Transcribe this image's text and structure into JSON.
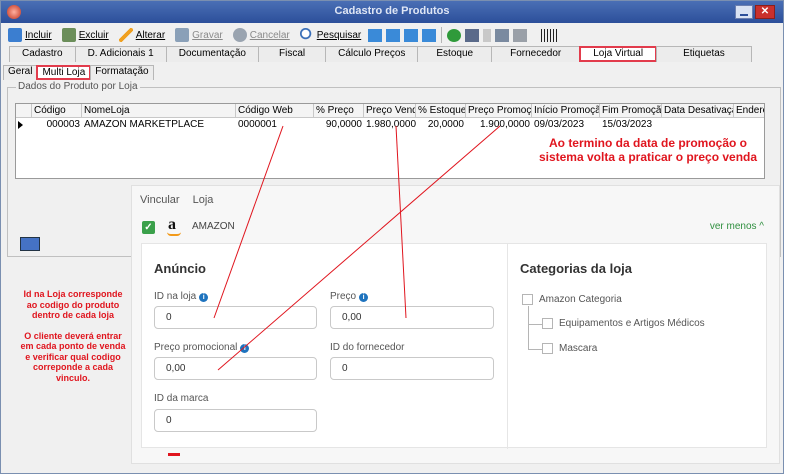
{
  "window": {
    "title": "Cadastro de Produtos"
  },
  "toolbar": {
    "incluir": "Incluir",
    "excluir": "Excluir",
    "alterar": "Alterar",
    "gravar": "Gravar",
    "cancelar": "Cancelar",
    "pesquisar": "Pesquisar"
  },
  "tabs_main": [
    "Cadastro",
    "D. Adicionais 1",
    "Documentação",
    "Fiscal",
    "Cálculo Preços",
    "Estoque",
    "Fornecedor",
    "Loja Virtual",
    "Etiquetas"
  ],
  "tabs_sub": [
    "Geral",
    "Multi Loja",
    "Formatação"
  ],
  "group": {
    "title": "Dados do Produto por Loja"
  },
  "grid": {
    "headers": [
      "Código",
      "NomeLoja",
      "Código Web",
      "% Preço",
      "Preço Venda",
      "% Estoque",
      "Preço Promoção",
      "Início  Promoção",
      "Fim Promoção",
      "Data Desativação",
      "Endereço"
    ],
    "row": [
      "000003",
      "AMAZON MARKETPLACE",
      "0000001",
      "90,0000",
      "1.980,0000",
      "20,0000",
      "1.900,0000",
      "09/03/2023",
      "15/03/2023",
      "",
      ""
    ]
  },
  "annotations": {
    "top_right_1": "Ao termino da data de promoção o",
    "top_right_2": "sistema volta a praticar o preço venda",
    "left_1": "Id na Loja corresponde",
    "left_2": "ao codigo do produto",
    "left_3": "dentro de cada loja",
    "left_4": "O cliente deverá entrar",
    "left_5": "em cada ponto de venda",
    "left_6": "e verificar qual codigo",
    "left_7": "correponde a cada",
    "left_8": "vinculo."
  },
  "overlay": {
    "vincular": "Vincular",
    "loja": "Loja",
    "store_name": "AMAZON",
    "ver_menos": "ver menos ^",
    "anuncio": "Anúncio",
    "id_na_loja_label": "ID na loja",
    "id_na_loja_value": "0",
    "preco_label": "Preço",
    "preco_value": "0,00",
    "preco_promocional_label": "Preço promocional",
    "preco_promocional_value": "0,00",
    "id_fornecedor_label": "ID do fornecedor",
    "id_fornecedor_value": "0",
    "id_marca_label": "ID da marca",
    "id_marca_value": "0",
    "categorias_title": "Categorias da loja",
    "categories": [
      "Amazon Categoria",
      "Equipamentos e Artigos Médicos",
      "Mascara"
    ]
  },
  "colors": {
    "accent_red": "#e0151e",
    "tab_highlight": "#e23b4c",
    "check_green": "#3aa04a",
    "link_green": "#2f8f3f",
    "info_blue": "#1e73be"
  }
}
